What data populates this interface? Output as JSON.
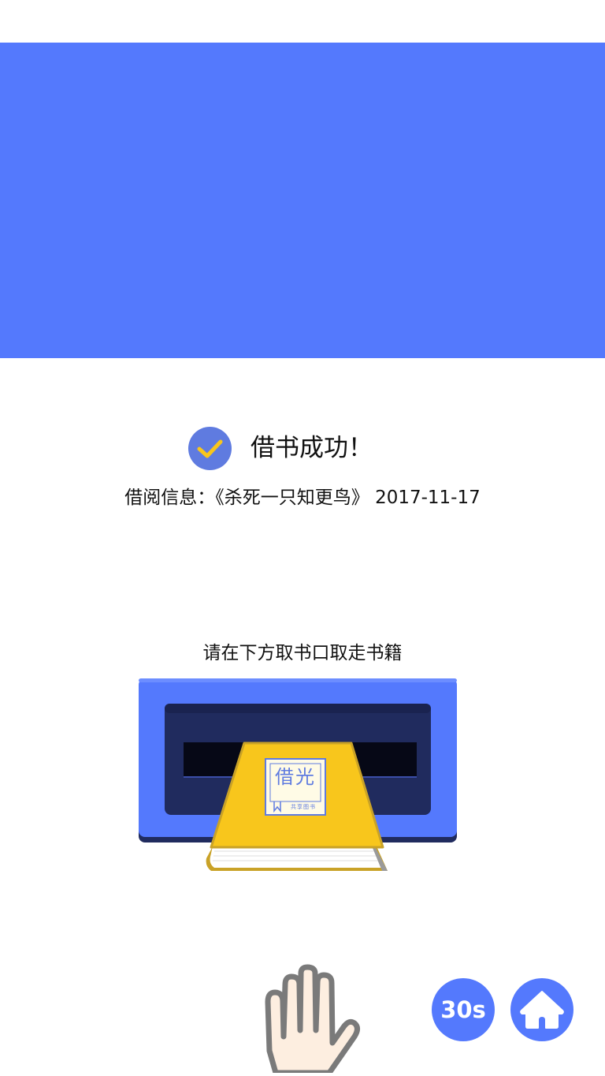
{
  "banner": {
    "color": "#5479fd"
  },
  "success": {
    "icon": "check-icon",
    "title": "借书成功！"
  },
  "borrow": {
    "label": "借阅信息：",
    "book_title": "《杀死一只知更鸟》",
    "date": "2017-11-17"
  },
  "instruction": "请在下方取书口取走书籍",
  "book_cover": {
    "title": "借光",
    "subtitle": "共享图书"
  },
  "timer": {
    "label": "30s"
  },
  "home": {
    "icon": "home-icon"
  },
  "colors": {
    "accent": "#5479fd",
    "check_circle": "#5f7be0",
    "check_mark": "#f8c61c",
    "book": "#f8c61c",
    "slot_dark": "#202b5e"
  }
}
